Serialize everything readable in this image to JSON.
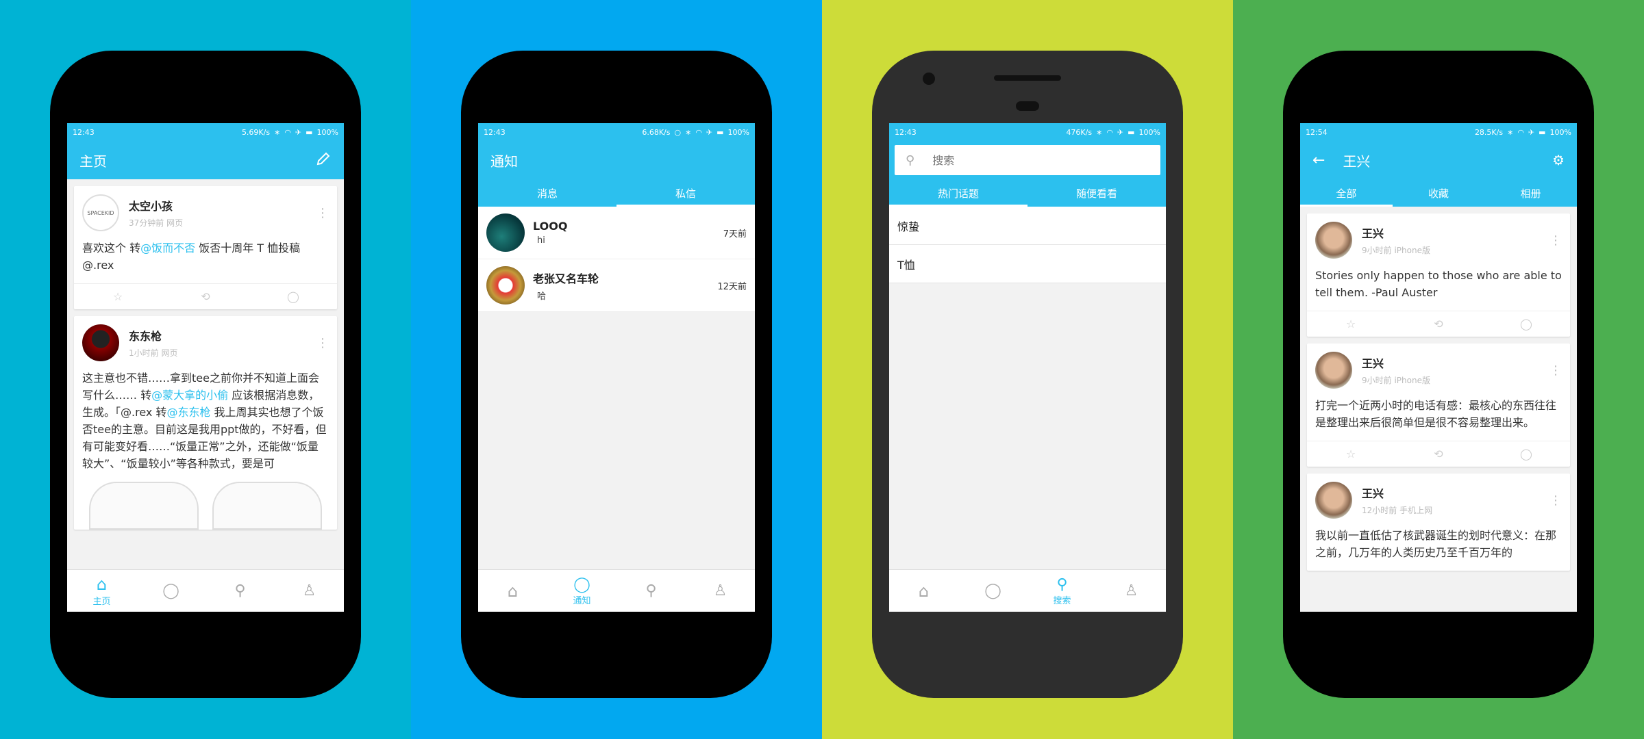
{
  "colors": {
    "panel1": "#00b3d4",
    "panel2": "#02a8f0",
    "panel3": "#cddc39",
    "panel4": "#4caf50",
    "accent": "#2cc0ee"
  },
  "screen1": {
    "status": {
      "time": "12:43",
      "speed": "5.69K/s",
      "battery": "100%"
    },
    "title": "主页",
    "posts": [
      {
        "name": "太空小孩",
        "meta": "37分钟前  网页",
        "avatar_text": "SPACEKID",
        "text_a": "喜欢这个 转",
        "link_a": "@饭而不否",
        "text_b": " 饭否十周年 T 恤投稿 @.rex"
      },
      {
        "name": "东东枪",
        "meta": "1小时前  网页",
        "text_a": "这主意也不错……拿到tee之前你并不知道上面会写什么…… 转",
        "link_a": "@蒙大拿的小偷",
        "text_b": " 应该根据消息数，生成。「@.rex 转",
        "link_b": "@东东枪",
        "text_c": " 我上周其实也想了个饭否tee的主意。目前这是我用ppt做的，不好看，但有可能变好看……“饭量正常”之外，还能做“饭量较大”、“饭量较小”等各种款式，要是可"
      }
    ],
    "nav": [
      "主页",
      "",
      "",
      ""
    ]
  },
  "screen2": {
    "status": {
      "time": "12:43",
      "speed": "6.68K/s",
      "battery": "100%"
    },
    "title": "通知",
    "tabs": [
      "消息",
      "私信"
    ],
    "messages": [
      {
        "name": "LOOQ",
        "msg": "hi",
        "time": "7天前"
      },
      {
        "name": "老张又名车轮",
        "msg": "哈",
        "time": "12天前"
      }
    ],
    "nav": [
      "",
      "通知",
      "",
      ""
    ]
  },
  "screen3": {
    "status": {
      "time": "12:43",
      "speed": "476K/s",
      "battery": "100%"
    },
    "search_placeholder": "搜索",
    "tabs": [
      "热门话题",
      "随便看看"
    ],
    "topics": [
      "惊蛰",
      "T恤"
    ],
    "nav": [
      "",
      "",
      "搜索",
      ""
    ]
  },
  "screen4": {
    "status": {
      "time": "12:54",
      "speed": "28.5K/s",
      "battery": "100%"
    },
    "title": "王兴",
    "tabs": [
      "全部",
      "收藏",
      "相册"
    ],
    "posts": [
      {
        "name": "王兴",
        "meta": "9小时前  iPhone版",
        "text": "Stories only happen to those who are able to tell them. -Paul Auster"
      },
      {
        "name": "王兴",
        "meta": "9小时前  iPhone版",
        "text": "打完一个近两小时的电话有感：最核心的东西往往是整理出来后很简单但是很不容易整理出来。"
      },
      {
        "name": "王兴",
        "meta": "12小时前  手机上网",
        "text": "我以前一直低估了核武器诞生的划时代意义：在那之前，几万年的人类历史乃至千百万年的"
      }
    ]
  }
}
